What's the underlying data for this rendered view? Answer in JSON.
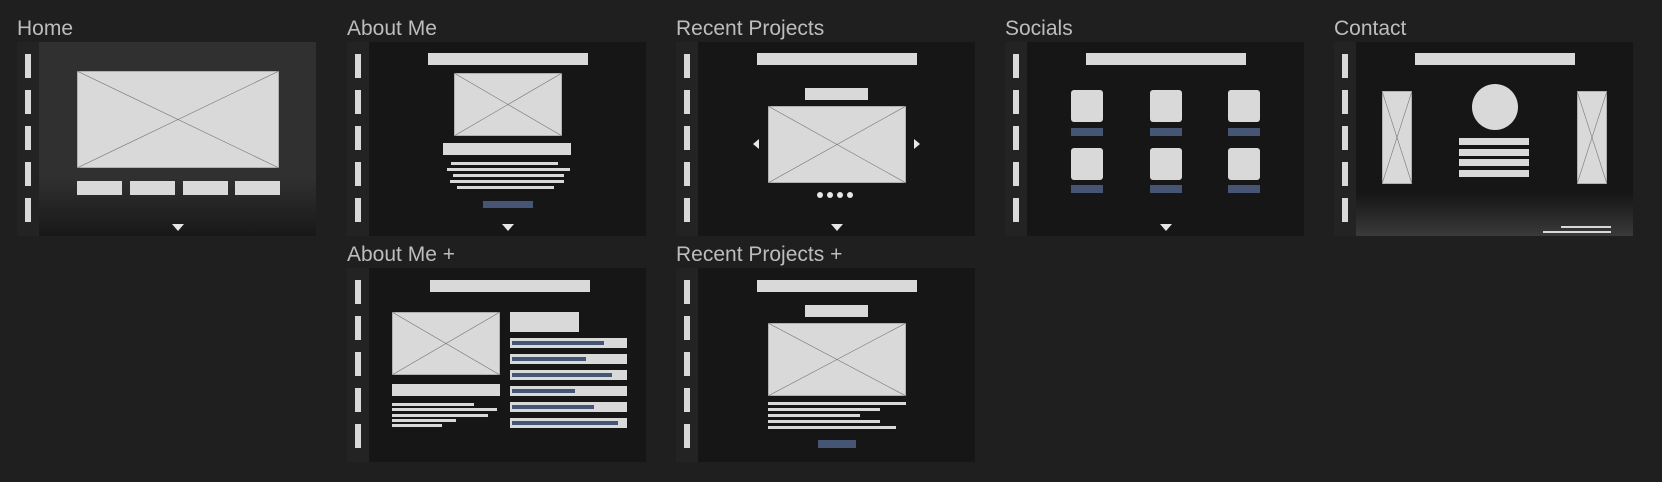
{
  "frames": {
    "home": {
      "title": "Home"
    },
    "about": {
      "title": "About Me"
    },
    "recent": {
      "title": "Recent Projects"
    },
    "socials": {
      "title": "Socials"
    },
    "contact": {
      "title": "Contact"
    },
    "about_plus": {
      "title": "About Me +"
    },
    "recent_plus": {
      "title": "Recent Projects +"
    }
  },
  "colors": {
    "canvas": "#1f1f1f",
    "board": "#161616",
    "sidebar": "#232323",
    "placeholder": "#d9d9d9",
    "accent": "#475574"
  },
  "icons": [
    "image-placeholder-icon",
    "chevron-down-icon",
    "chevron-left-icon",
    "chevron-right-icon"
  ]
}
